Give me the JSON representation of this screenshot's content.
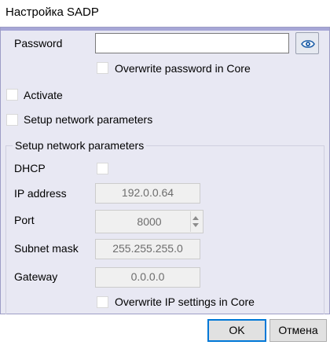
{
  "window": {
    "title": "Настройка SADP"
  },
  "password": {
    "label": "Password",
    "value": "",
    "show_password_icon": "eye-icon",
    "overwrite_label": "Overwrite password in Core"
  },
  "options": {
    "activate_label": "Activate",
    "setup_network_label": "Setup network parameters"
  },
  "network": {
    "caption": "Setup network parameters",
    "dhcp_label": "DHCP",
    "ip_label": "IP address",
    "ip_value": "192.0.0.64",
    "port_label": "Port",
    "port_value": "8000",
    "subnet_label": "Subnet mask",
    "subnet_value": "255.255.255.0",
    "gateway_label": "Gateway",
    "gateway_value": "0.0.0.0",
    "overwrite_ip_label": "Overwrite IP settings in Core"
  },
  "footer": {
    "ok_label": "OK",
    "cancel_label": "Отмена"
  },
  "colors": {
    "panel_bg": "#e8e8f3",
    "panel_top_bar": "#a6a6d6",
    "primary_border": "#0078d7"
  }
}
